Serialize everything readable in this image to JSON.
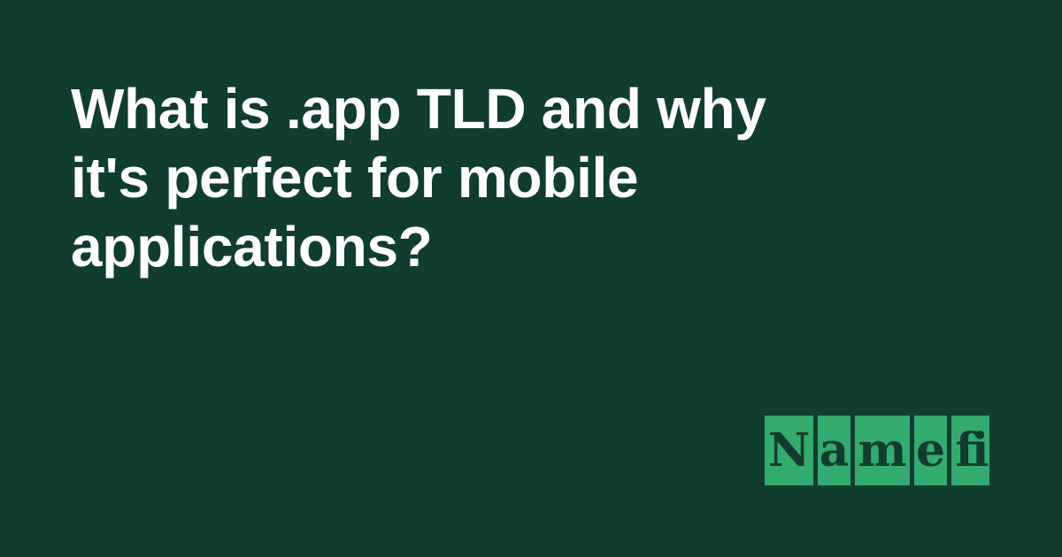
{
  "title_lines": [
    "What is .app TLD and why",
    "it's perfect for mobile",
    "applications?"
  ],
  "logo": {
    "text": "Namefi",
    "tiles": [
      "N",
      "a",
      "m",
      "e",
      "fi"
    ]
  },
  "colors": {
    "background": "#113d2e",
    "logo_green": "#33ab6f",
    "title": "#ffffff"
  }
}
